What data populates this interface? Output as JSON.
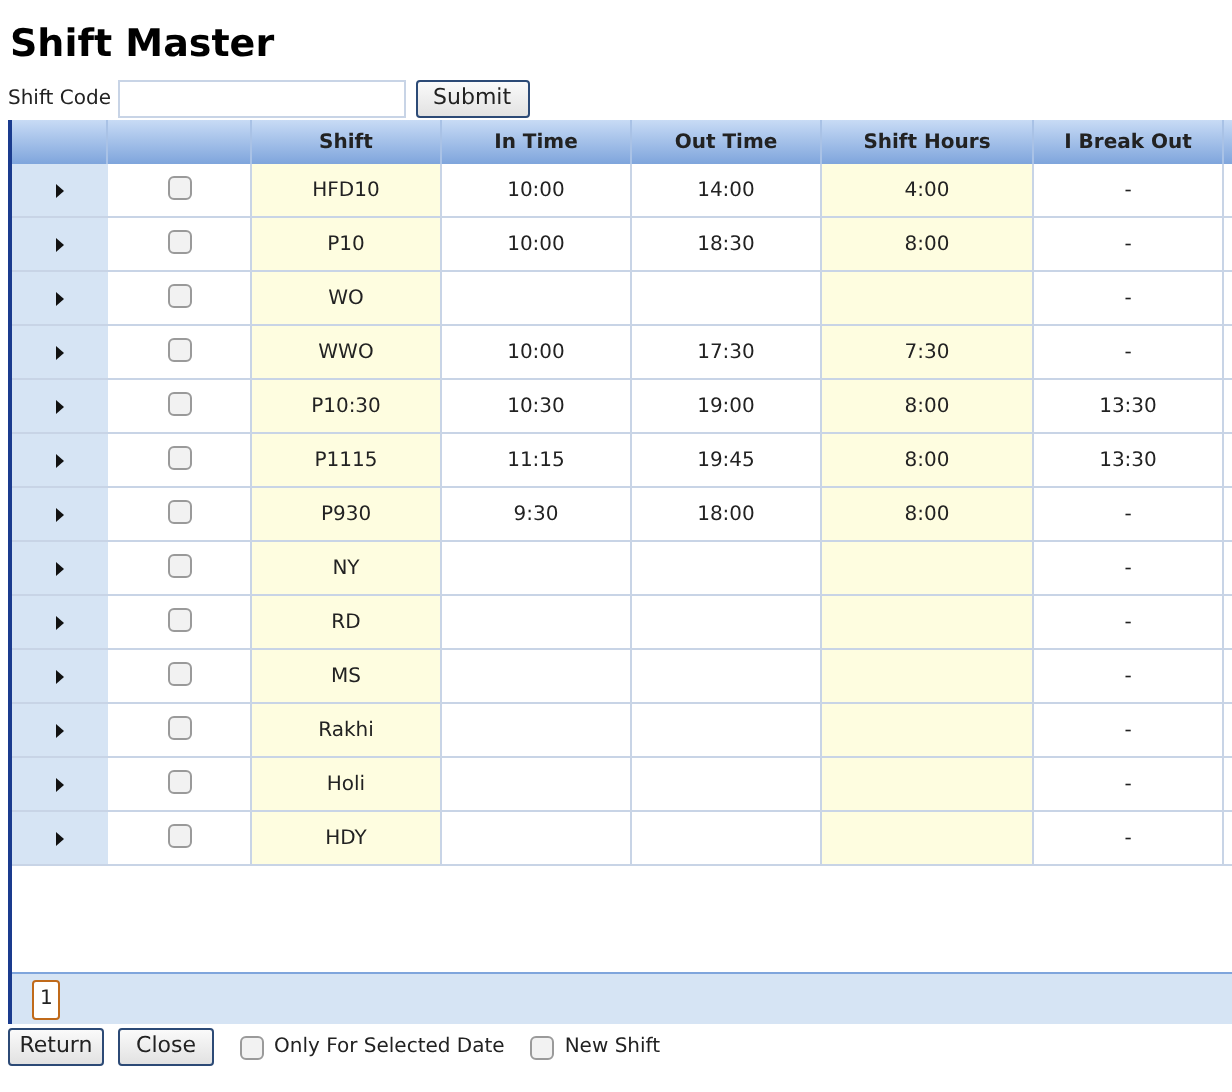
{
  "title": "Shift Master",
  "search": {
    "label": "Shift Code",
    "button": "Submit"
  },
  "table": {
    "columns": [
      "Shift",
      "In Time",
      "Out Time",
      "Shift Hours",
      "I Break Out"
    ],
    "rows": [
      {
        "checked": false,
        "shift": "HFD10",
        "in_time": "10:00",
        "out_time": "14:00",
        "shift_hours": "4:00",
        "break_out": "-"
      },
      {
        "checked": false,
        "shift": "P10",
        "in_time": "10:00",
        "out_time": "18:30",
        "shift_hours": "8:00",
        "break_out": "-"
      },
      {
        "checked": false,
        "shift": "WO",
        "break_out": "-"
      },
      {
        "checked": false,
        "shift": "WWO",
        "in_time": "10:00",
        "out_time": "17:30",
        "shift_hours": "7:30",
        "break_out": "-"
      },
      {
        "checked": false,
        "shift": "P10:30",
        "in_time": "10:30",
        "out_time": "19:00",
        "shift_hours": "8:00",
        "break_out": "13:30"
      },
      {
        "checked": false,
        "shift": "P1115",
        "in_time": "11:15",
        "out_time": "19:45",
        "shift_hours": "8:00",
        "break_out": "13:30"
      },
      {
        "checked": false,
        "shift": "P930",
        "in_time": "9:30",
        "out_time": "18:00",
        "shift_hours": "8:00",
        "break_out": "-"
      },
      {
        "checked": false,
        "shift": "NY",
        "break_out": "-"
      },
      {
        "checked": false,
        "shift": "RD",
        "break_out": "-"
      },
      {
        "checked": false,
        "shift": "MS",
        "break_out": "-"
      },
      {
        "checked": false,
        "shift": "Rakhi",
        "break_out": "-"
      },
      {
        "checked": false,
        "shift": "Holi",
        "break_out": "-"
      },
      {
        "checked": false,
        "shift": "HDY",
        "break_out": "-"
      }
    ],
    "pager": [
      {
        "label": "1",
        "selected": true
      }
    ]
  },
  "footer": {
    "buttons": [
      "Return",
      "Close"
    ],
    "options": [
      {
        "label": "Only For Selected Date",
        "checked": false
      },
      {
        "label": "New Shift",
        "checked": false
      }
    ]
  }
}
